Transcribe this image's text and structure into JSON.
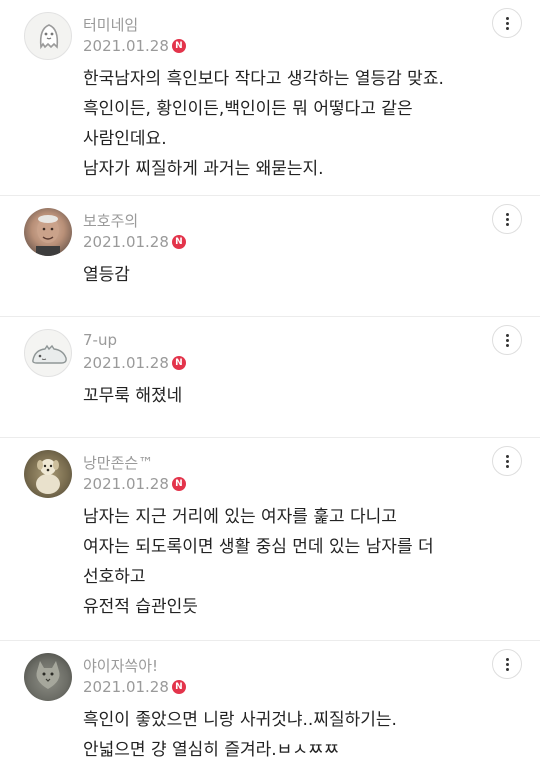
{
  "comments": [
    {
      "author": "터미네임",
      "date": "2021.01.28",
      "badge": "N",
      "avatar_icon": "egg-ghost-avatar",
      "lines": [
        "한국남자의 흑인보다 작다고 생각하는 열등감 맞죠.",
        "흑인이든, 황인이든,백인이든 뭐 어떻다고 같은",
        "사람인데요.",
        "남자가 찌질하게 과거는 왜묻는지."
      ]
    },
    {
      "author": "보호주의",
      "date": "2021.01.28",
      "badge": "N",
      "avatar_icon": "person-photo-avatar",
      "lines": [
        "열등감"
      ]
    },
    {
      "author": "7-up",
      "date": "2021.01.28",
      "badge": "N",
      "avatar_icon": "creature-avatar",
      "lines": [
        "꼬무룩 해졌네"
      ]
    },
    {
      "author": "낭만존슨™",
      "date": "2021.01.28",
      "badge": "N",
      "avatar_icon": "dog-photo-avatar",
      "lines": [
        "남자는 지근 거리에 있는 여자를 훑고 다니고",
        "여자는 되도록이면 생활 중심 먼데 있는 남자를 더",
        "선호하고",
        "유전적 습관인듯"
      ]
    },
    {
      "author": "야이자쓱아!",
      "date": "2021.01.28",
      "badge": "N",
      "avatar_icon": "cat-photo-avatar",
      "lines": [
        "흑인이 좋았으면 니랑 사귀것냐..찌질하기는.",
        "안넓으면 걍 열심히 즐겨라.ㅂㅅㅉㅉ"
      ]
    }
  ]
}
